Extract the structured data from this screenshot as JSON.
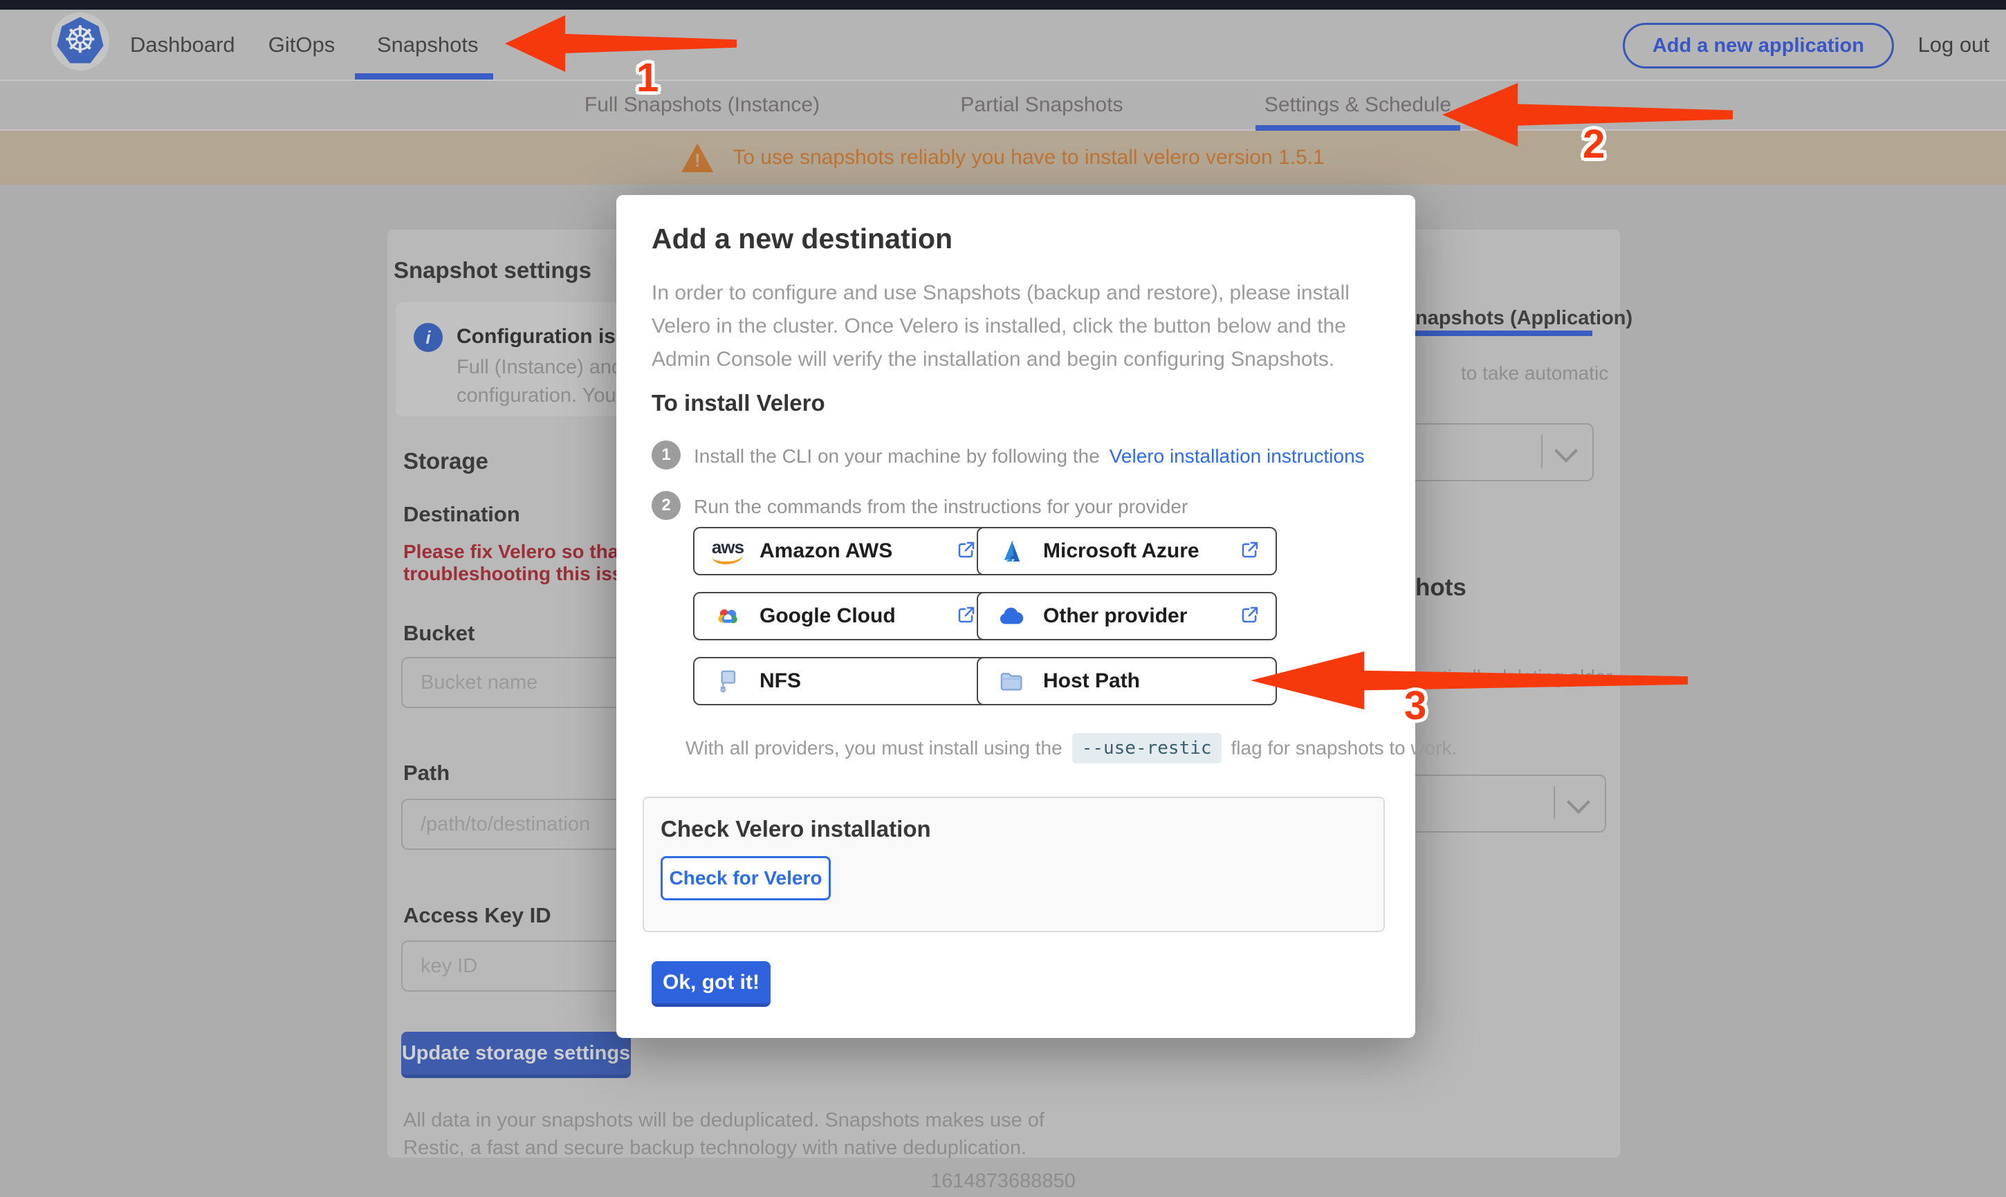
{
  "topbar": {
    "nav_items": [
      "Dashboard",
      "GitOps",
      "Snapshots"
    ],
    "active_item": "Snapshots",
    "add_application_button": "Add a new application",
    "logout": "Log out"
  },
  "subnav": {
    "tabs": [
      "Full Snapshots (Instance)",
      "Partial Snapshots (Application)",
      "Settings & Schedule"
    ],
    "active_tab": "Settings & Schedule"
  },
  "banner": {
    "text": "To use snapshots reliably you have to install velero version 1.5.1"
  },
  "settings_page": {
    "title": "Snapshot settings",
    "info_box": {
      "title": "Configuration is sh",
      "line1": "Full (Instance) and Parti",
      "line2": "configuration. Your stor"
    },
    "storage_heading": "Storage",
    "destination_heading": "Destination",
    "error_line1": "Please fix Velero so that th",
    "error_line2": "troubleshooting this issue",
    "bucket_label": "Bucket",
    "bucket_placeholder": "Bucket name",
    "path_label": "Path",
    "path_placeholder": "/path/to/destination",
    "access_key_label": "Access Key ID",
    "access_key_placeholder": "key ID",
    "update_button": "Update storage settings",
    "footnote_line1": "All data in your snapshots will be deduplicated. Snapshots makes use of",
    "footnote_line2": "Restic, a fast and secure backup technology with native deduplication."
  },
  "right_panel": {
    "tab_label": "napshots (Application)",
    "text1": "to take automatic",
    "heading": "hots",
    "text2": "matically deleting older"
  },
  "modal": {
    "title": "Add a new destination",
    "intro": "In order to configure and use Snapshots (backup and restore), please install Velero in the cluster. Once Velero is installed, click the button below and the Admin Console will verify the installation and begin configuring Snapshots.",
    "install_heading": "To install Velero",
    "step1_num": "1",
    "step1_text": "Install the CLI on your machine by following the",
    "step1_link": "Velero installation instructions",
    "step2_num": "2",
    "step2_text": "Run the commands from the instructions for your provider",
    "providers": [
      {
        "name": "Amazon AWS",
        "icon": "aws-logo-icon"
      },
      {
        "name": "Microsoft Azure",
        "icon": "azure-logo-icon"
      },
      {
        "name": "Google Cloud",
        "icon": "google-cloud-logo-icon"
      },
      {
        "name": "Other provider",
        "icon": "cloud-icon"
      },
      {
        "name": "NFS",
        "icon": "nfs-icon"
      },
      {
        "name": "Host Path",
        "icon": "folder-icon"
      }
    ],
    "restic_prefix": "With all providers, you must install using the",
    "restic_code": "--use-restic",
    "restic_suffix": "flag for snapshots to work.",
    "check_title": "Check Velero installation",
    "check_button": "Check for Velero",
    "ok_button": "Ok, got it!"
  },
  "annotations": {
    "label1": "1",
    "label2": "2",
    "label3": "3"
  },
  "footer": {
    "timestamp": "1614873688850"
  },
  "colors": {
    "accent_blue": "#2e6ce4",
    "underline_blue": "#3b5ec4",
    "arrow_red": "#f6380d",
    "banner_bg": "#b3a794",
    "banner_orange": "#bf7434",
    "error_red": "#9c2f37"
  }
}
